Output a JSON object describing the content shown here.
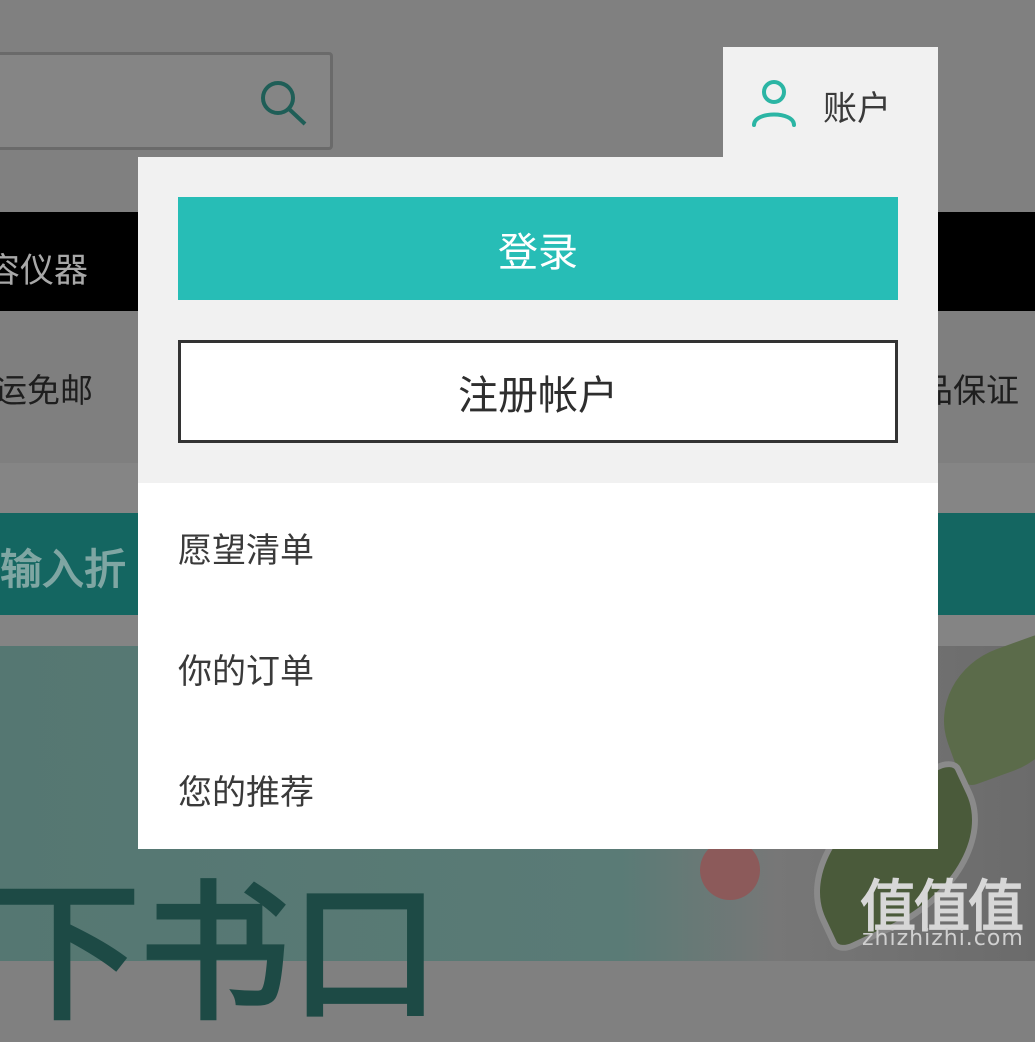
{
  "background": {
    "nav_item_partial": "容仪器",
    "benefit_left_partial": "运免邮",
    "benefit_right_partial": "品保证",
    "promo_partial": "请输入折",
    "hero_text_partial": "下书口",
    "watermark": "值值值",
    "watermark_sub": "zhizhizhi.com"
  },
  "header": {
    "search_icon": "search-icon",
    "account_icon": "user-icon",
    "account_label": "账户"
  },
  "dropdown": {
    "login_label": "登录",
    "register_label": "注册帐户",
    "menu": [
      {
        "label": "愿望清单"
      },
      {
        "label": "你的订单"
      },
      {
        "label": "您的推荐"
      }
    ]
  },
  "colors": {
    "accent": "#27bdb6",
    "user_icon": "#2bb5a4",
    "overlay": "#808080"
  }
}
